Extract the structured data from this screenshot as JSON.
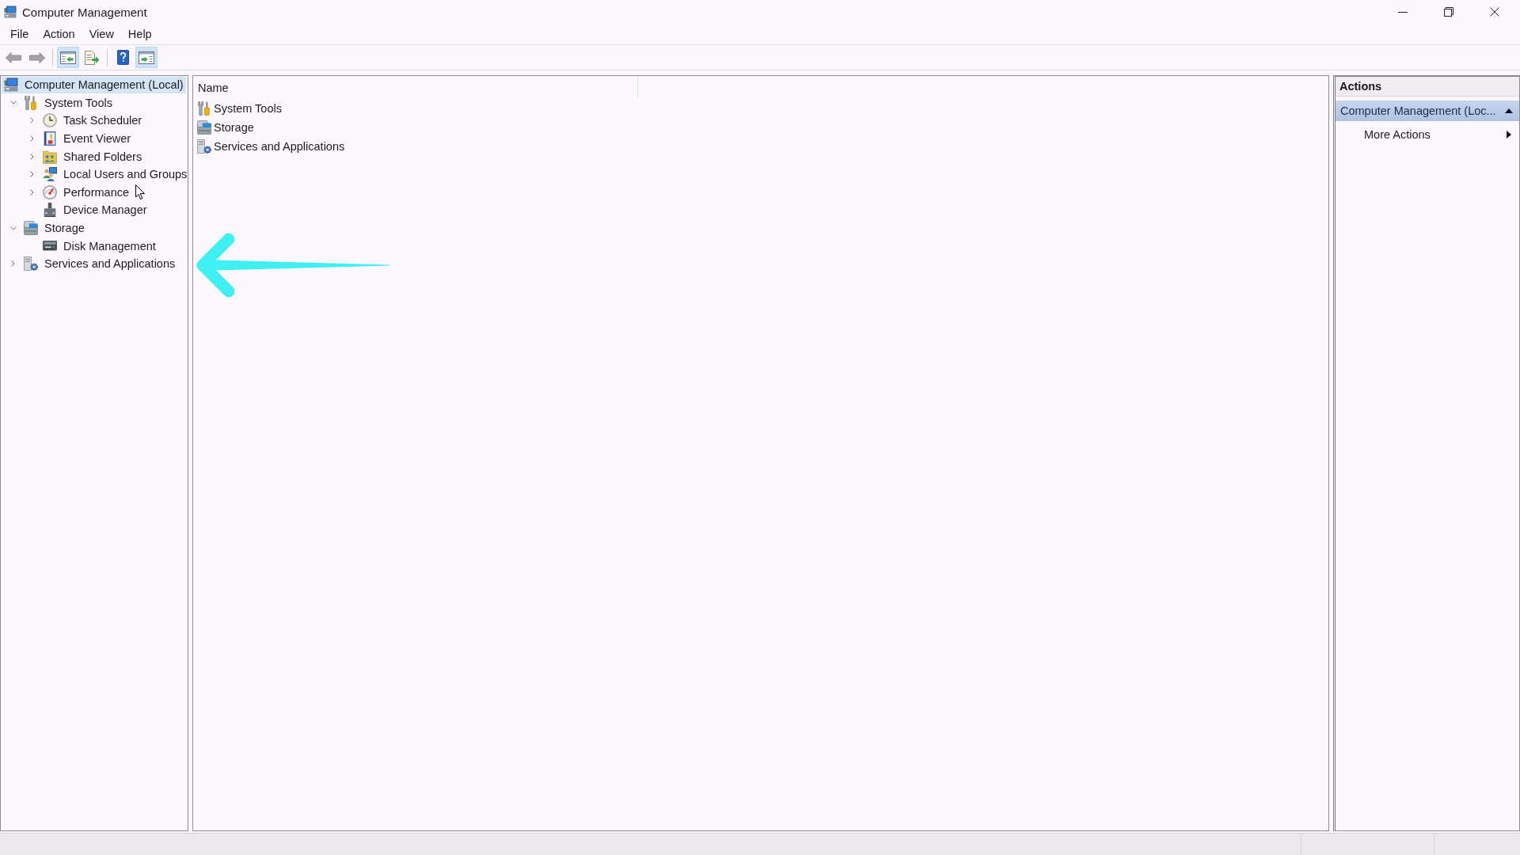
{
  "window": {
    "title": "Computer Management"
  },
  "menu": [
    "File",
    "Action",
    "View",
    "Help"
  ],
  "toolbar": [
    {
      "buttons": [
        {
          "kind": "back",
          "disabled": true,
          "on": false
        },
        {
          "kind": "forward",
          "disabled": true,
          "on": false
        }
      ]
    },
    {
      "buttons": [
        {
          "kind": "console-tree",
          "disabled": false,
          "on": true
        },
        {
          "kind": "export",
          "disabled": false,
          "on": false
        }
      ]
    },
    {
      "buttons": [
        {
          "kind": "help",
          "disabled": false,
          "on": false
        },
        {
          "kind": "action-pane",
          "disabled": false,
          "on": true
        }
      ]
    }
  ],
  "tree": {
    "root": {
      "label": "Computer Management (Local)",
      "kind": "computer",
      "selected": true,
      "children": [
        {
          "label": "System Tools",
          "kind": "tools",
          "selected": false,
          "expanded": true,
          "children": [
            {
              "label": "Task Scheduler",
              "kind": "scheduler",
              "selected": false,
              "expanded": false
            },
            {
              "label": "Event Viewer",
              "kind": "viewer",
              "selected": false,
              "expanded": false
            },
            {
              "label": "Shared Folders",
              "kind": "folders",
              "selected": false,
              "expanded": false
            },
            {
              "label": "Local Users and Groups",
              "kind": "users",
              "selected": false,
              "expanded": false
            },
            {
              "label": "Performance",
              "kind": "performance",
              "selected": false,
              "expanded": false
            },
            {
              "label": "Device Manager",
              "kind": "devices",
              "selected": false
            }
          ]
        },
        {
          "label": "Storage",
          "kind": "storage",
          "selected": false,
          "expanded": true,
          "children": [
            {
              "label": "Disk Management",
              "kind": "disk",
              "selected": false
            }
          ]
        },
        {
          "label": "Services and Applications",
          "kind": "services",
          "selected": false,
          "expanded": false
        }
      ]
    }
  },
  "list": {
    "columns": [
      "Name"
    ],
    "rows": [
      {
        "label": "System Tools",
        "kind": "tools",
        "selected": false
      },
      {
        "label": "Storage",
        "kind": "storage",
        "selected": false
      },
      {
        "label": "Services and Applications",
        "kind": "services",
        "selected": false
      }
    ]
  },
  "actions": {
    "title": "Actions",
    "sections": [
      {
        "label": "Computer Management (Loc...",
        "expanded": true,
        "items": [
          {
            "label": "More Actions",
            "submenu": true
          }
        ]
      }
    ]
  }
}
